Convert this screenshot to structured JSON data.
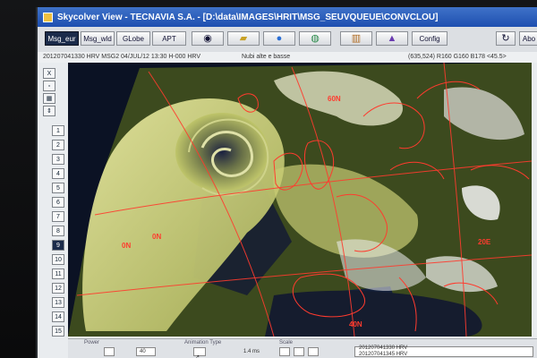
{
  "window": {
    "title": "Skycolver View - TECNAVIA S.A. - [D:\\data\\IMAGES\\HRIT\\MSG_SEUVQUEUE\\CONVCLOU]"
  },
  "toolbar": {
    "buttons": [
      "Msg_eur",
      "Msg_wld",
      "GLobe",
      "APT"
    ],
    "config_label": "Config",
    "abort_label": "Abo"
  },
  "status": {
    "image_info": "201207041330 HRV MSG2 04/JUL/12 13:30 H-000 HRV",
    "product": "Nubi alte e basse",
    "cursor_info": "(635,524) R160 G160 B178 <45.5>"
  },
  "sidebar": {
    "tools": [
      "X",
      "",
      "",
      ""
    ],
    "numbers": [
      "1",
      "2",
      "3",
      "4",
      "5",
      "6",
      "7",
      "8",
      "9",
      "10",
      "11",
      "12",
      "13",
      "14",
      "15"
    ],
    "selected": "9"
  },
  "map": {
    "grid_labels": {
      "lat_60n": "60N",
      "lat_40n": "40N",
      "lon_20e": "20E",
      "lon_left_a": "0N",
      "lon_left_b": "0N"
    }
  },
  "bottom": {
    "power_label": "Power",
    "power_value": "40",
    "animation_label": "Animation Type",
    "speed_value": "1.4 ms",
    "scale_label": "Scale",
    "list_items": [
      "201207041330 HRV",
      "201207041345 HRV"
    ]
  },
  "colors": {
    "grid_red": "#ff3b2e",
    "title_blue": "#1e4fb0",
    "land_green": "#5a6a2a",
    "cloud_yellow": "#d9dc7a"
  }
}
